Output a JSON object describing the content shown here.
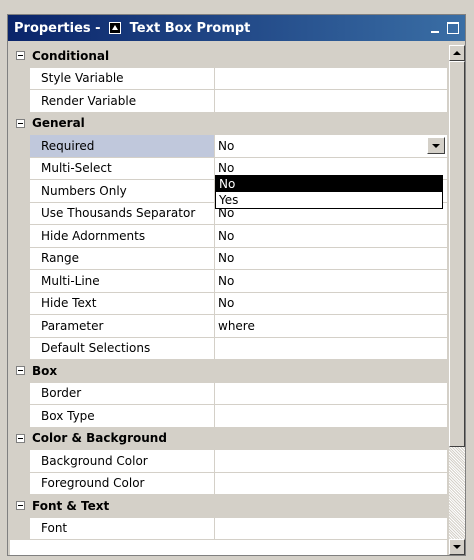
{
  "window": {
    "title_prefix": "Properties -",
    "title_suffix": "Text Box Prompt",
    "icon": "text-box-icon"
  },
  "rows": [
    {
      "type": "category",
      "name": "Conditional"
    },
    {
      "type": "property",
      "name": "Style Variable",
      "value": ""
    },
    {
      "type": "property",
      "name": "Render Variable",
      "value": ""
    },
    {
      "type": "category",
      "name": "General"
    },
    {
      "type": "property",
      "name": "Required",
      "value": "No",
      "selected": true
    },
    {
      "type": "property",
      "name": "Multi-Select",
      "value": "No"
    },
    {
      "type": "property",
      "name": "Numbers Only",
      "value": "No"
    },
    {
      "type": "property",
      "name": "Use Thousands Separator",
      "value": "No"
    },
    {
      "type": "property",
      "name": "Hide Adornments",
      "value": "No"
    },
    {
      "type": "property",
      "name": "Range",
      "value": "No"
    },
    {
      "type": "property",
      "name": "Multi-Line",
      "value": "No"
    },
    {
      "type": "property",
      "name": "Hide Text",
      "value": "No"
    },
    {
      "type": "property",
      "name": "Parameter",
      "value": "where"
    },
    {
      "type": "property",
      "name": "Default Selections",
      "value": ""
    },
    {
      "type": "category",
      "name": "Box"
    },
    {
      "type": "property",
      "name": "Border",
      "value": ""
    },
    {
      "type": "property",
      "name": "Box Type",
      "value": ""
    },
    {
      "type": "category",
      "name": "Color & Background"
    },
    {
      "type": "property",
      "name": "Background Color",
      "value": ""
    },
    {
      "type": "property",
      "name": "Foreground Color",
      "value": ""
    },
    {
      "type": "category",
      "name": "Font & Text"
    },
    {
      "type": "property",
      "name": "Font",
      "value": ""
    }
  ],
  "dropdown": {
    "options": [
      "No",
      "Yes"
    ],
    "highlighted": "No"
  },
  "colors": {
    "title_start": "#0a246a",
    "title_end": "#3a6ea5",
    "selected_row": "#c0c8dc",
    "face": "#d4d0c8"
  }
}
